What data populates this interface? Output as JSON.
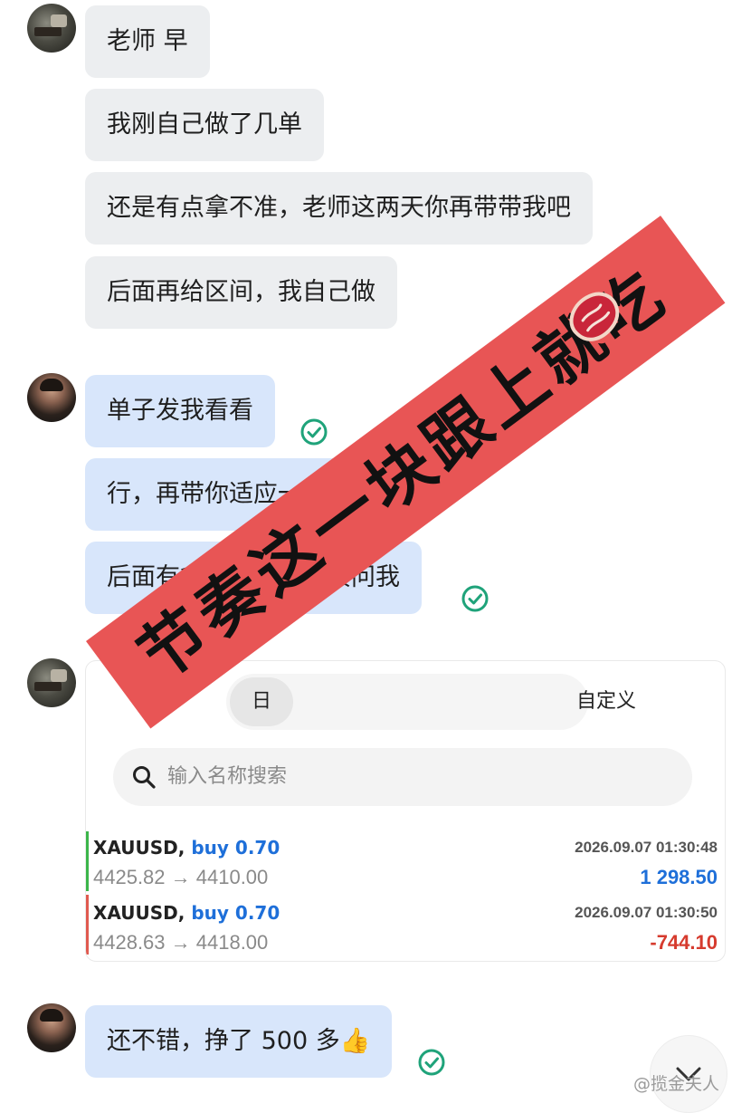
{
  "messages_incoming_1": [
    "老师 早",
    "我刚自己做了几单",
    "还是有点拿不准，老师这两天你再带带我吧",
    "后面再给区间，我自己做"
  ],
  "messages_outgoing_1": [
    "单子发我看看",
    "行，再带你适应一周",
    "后面有拿不准可以直接问我"
  ],
  "trade_card": {
    "segments": {
      "day": "日",
      "custom": "自定义"
    },
    "search_placeholder": "输入名称搜索",
    "trades": [
      {
        "symbol": "XAUUSD,",
        "side": "buy 0.70",
        "prices": "4425.82 → 4410.00",
        "time": "2026.09.07 01:30:48",
        "pnl": "1 298.50",
        "pnl_color": "#1e6fd9",
        "bar_color": "#3bb54a"
      },
      {
        "symbol": "XAUUSD,",
        "side": "buy 0.70",
        "prices": "4428.63 → 4418.00",
        "time": "2026.09.07 01:30:50",
        "pnl": "-744.10",
        "pnl_color": "#d63b2e",
        "bar_color": "#e05a4f"
      }
    ]
  },
  "message_outgoing_2": "还不错，挣了 500 多👍",
  "overlay_banner": "节奏这一块跟上就吃",
  "watermark": "@揽金夫人",
  "colors": {
    "incoming_bubble": "#eceef0",
    "outgoing_bubble": "#d8e6fb",
    "check": "#1fa37a",
    "banner": "#e85555"
  }
}
